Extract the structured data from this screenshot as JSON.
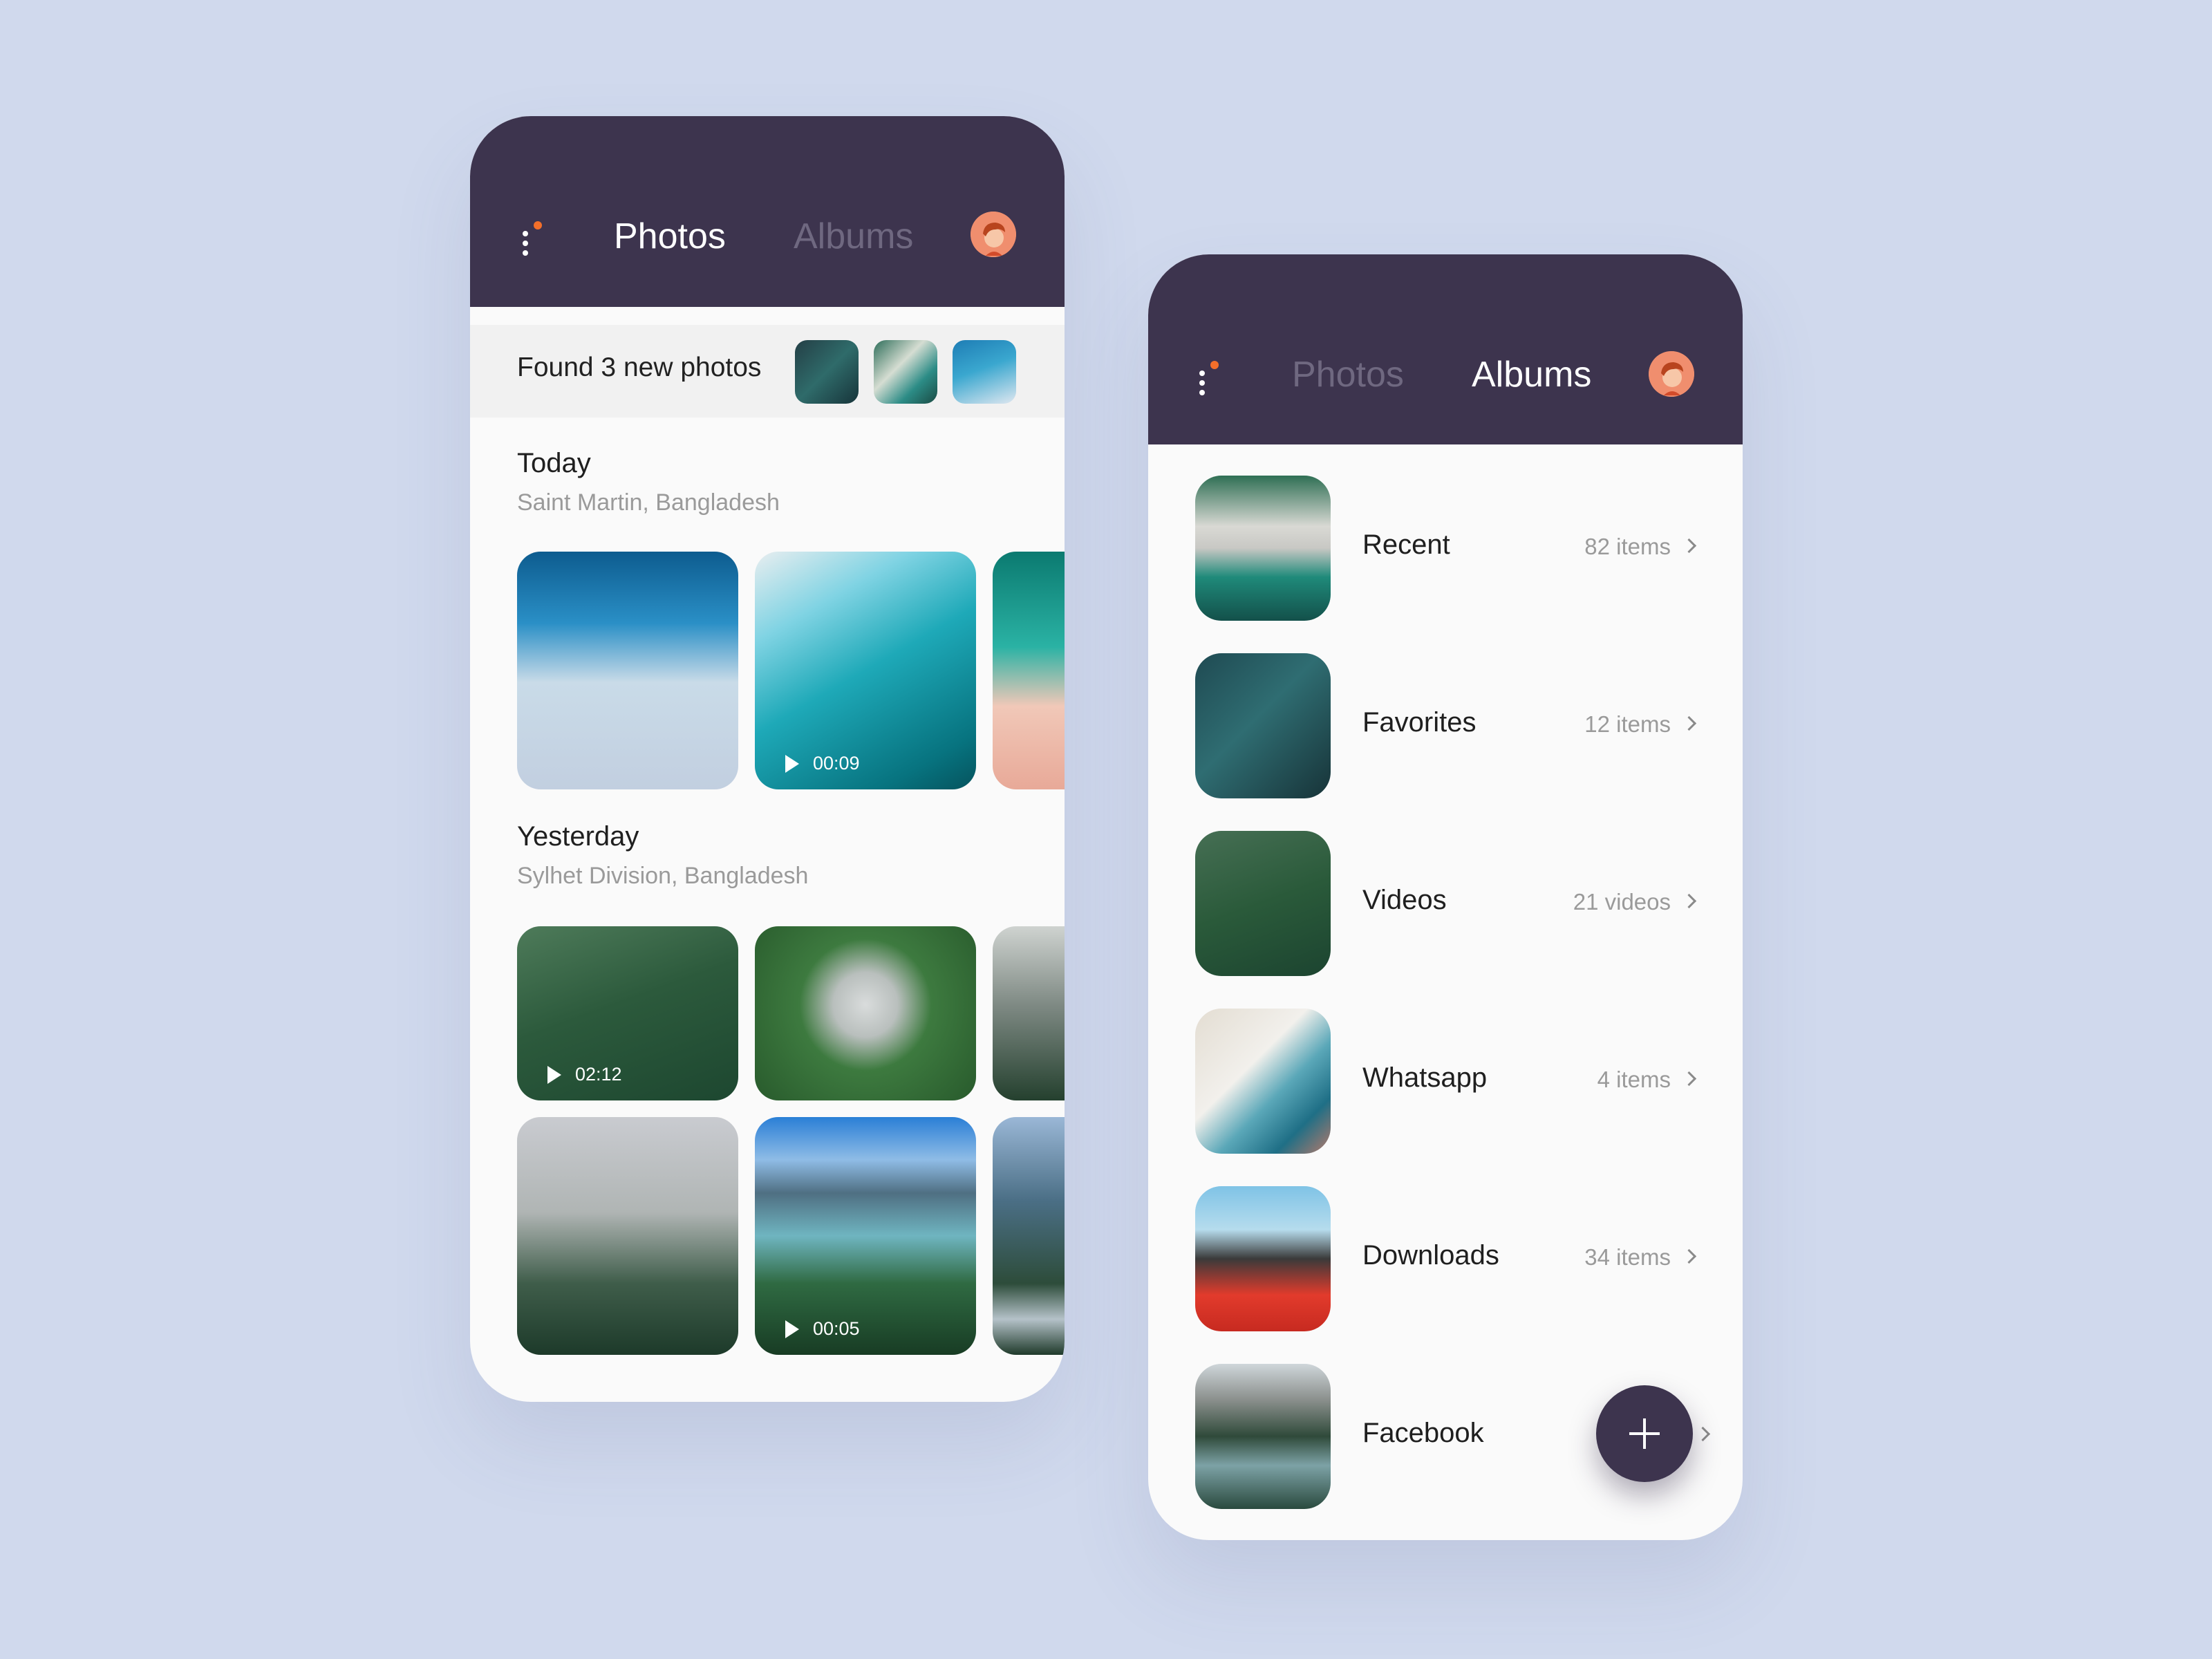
{
  "left_screen": {
    "tabs": {
      "photos": "Photos",
      "albums": "Albums"
    },
    "active_tab": "Photos",
    "found_banner": "Found 3 new photos",
    "sections": [
      {
        "title": "Today",
        "subtitle": "Saint Martin, Bangladesh",
        "video_durations": [
          "00:09"
        ]
      },
      {
        "title": "Yesterday",
        "subtitle": "Sylhet Division, Bangladesh",
        "video_durations": [
          "02:12",
          "00:05"
        ]
      }
    ]
  },
  "right_screen": {
    "tabs": {
      "photos": "Photos",
      "albums": "Albums"
    },
    "active_tab": "Albums",
    "albums": [
      {
        "name": "Recent",
        "count": "82 items"
      },
      {
        "name": "Favorites",
        "count": "12 items"
      },
      {
        "name": "Videos",
        "count": "21 videos"
      },
      {
        "name": "Whatsapp",
        "count": "4 items"
      },
      {
        "name": "Downloads",
        "count": "34 items"
      },
      {
        "name": "Facebook",
        "count": ""
      }
    ],
    "fab_icon": "plus-icon"
  },
  "colors": {
    "background": "#d0d9ed",
    "header": "#3d344e",
    "accent_dot": "#f36f2a",
    "avatar": "#f08e6e",
    "inactive_tab": "#6f6880"
  }
}
